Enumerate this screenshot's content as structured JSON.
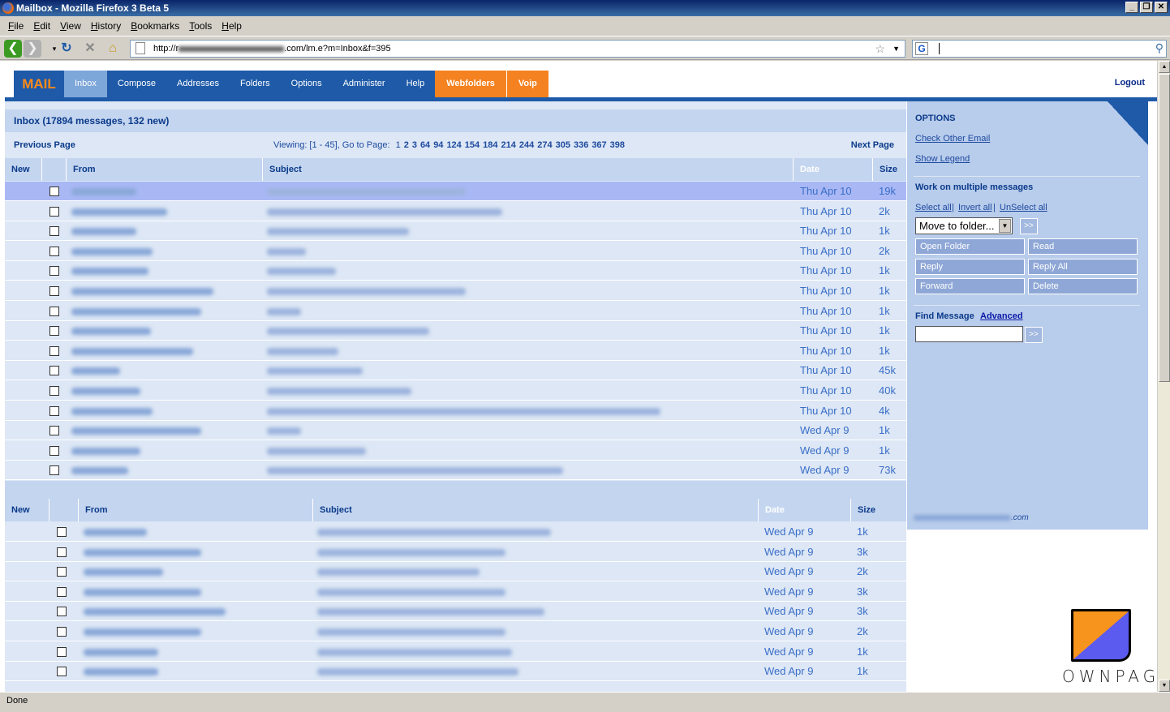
{
  "window": {
    "title": "Mailbox - Mozilla Firefox 3 Beta 5",
    "buttons": [
      "_",
      "❐",
      "✕"
    ]
  },
  "menu": [
    "File",
    "Edit",
    "View",
    "History",
    "Bookmarks",
    "Tools",
    "Help"
  ],
  "browser": {
    "url_prefix": "http://r",
    "url_suffix": ".com/lm.e?m=Inbox&f=395",
    "search_value": ""
  },
  "app": {
    "logo": "MAIL",
    "tabs": [
      "Inbox",
      "Compose",
      "Addresses",
      "Folders",
      "Options",
      "Administer",
      "Help"
    ],
    "orange_tabs": [
      "Webfolders",
      "Voip"
    ],
    "logout": "Logout"
  },
  "inbox": {
    "header": "Inbox (17894 messages, 132 new)",
    "previous": "Previous Page",
    "next": "Next Page",
    "viewing": "Viewing: [1 - 45], Go to Page:",
    "pages": [
      "1",
      "2",
      "3",
      "64",
      "94",
      "124",
      "154",
      "184",
      "214",
      "244",
      "274",
      "305",
      "336",
      "367",
      "398"
    ],
    "columns": {
      "new": "New",
      "from": "From",
      "subject": "Subject",
      "date": "Date",
      "size": "Size"
    },
    "rows_top": [
      {
        "date": "Thu Apr 10",
        "size": "19k",
        "sel": true,
        "fw": 80,
        "sw": 245
      },
      {
        "date": "Thu Apr 10",
        "size": "2k",
        "fw": 118,
        "sw": 290
      },
      {
        "date": "Thu Apr 10",
        "size": "1k",
        "fw": 80,
        "sw": 175
      },
      {
        "date": "Thu Apr 10",
        "size": "2k",
        "fw": 100,
        "sw": 48
      },
      {
        "date": "Thu Apr 10",
        "size": "1k",
        "fw": 95,
        "sw": 85
      },
      {
        "date": "Thu Apr 10",
        "size": "1k",
        "fw": 175,
        "sw": 245
      },
      {
        "date": "Thu Apr 10",
        "size": "1k",
        "fw": 160,
        "sw": 42
      },
      {
        "date": "Thu Apr 10",
        "size": "1k",
        "fw": 98,
        "sw": 200
      },
      {
        "date": "Thu Apr 10",
        "size": "1k",
        "fw": 150,
        "sw": 88
      },
      {
        "date": "Thu Apr 10",
        "size": "45k",
        "fw": 60,
        "sw": 118
      },
      {
        "date": "Thu Apr 10",
        "size": "40k",
        "fw": 85,
        "sw": 178
      },
      {
        "date": "Thu Apr 10",
        "size": "4k",
        "fw": 100,
        "sw": 485
      },
      {
        "date": "Wed Apr 9",
        "size": "1k",
        "fw": 160,
        "sw": 42
      },
      {
        "date": "Wed Apr 9",
        "size": "1k",
        "fw": 85,
        "sw": 122
      },
      {
        "date": "Wed Apr 9",
        "size": "73k",
        "fw": 70,
        "sw": 365
      }
    ],
    "rows_bottom": [
      {
        "date": "Wed Apr 9",
        "size": "1k",
        "fw": 78,
        "sw": 288
      },
      {
        "date": "Wed Apr 9",
        "size": "3k",
        "fw": 145,
        "sw": 232
      },
      {
        "date": "Wed Apr 9",
        "size": "2k",
        "fw": 98,
        "sw": 200
      },
      {
        "date": "Wed Apr 9",
        "size": "3k",
        "fw": 145,
        "sw": 232
      },
      {
        "date": "Wed Apr 9",
        "size": "3k",
        "fw": 175,
        "sw": 280
      },
      {
        "date": "Wed Apr 9",
        "size": "2k",
        "fw": 145,
        "sw": 232
      },
      {
        "date": "Wed Apr 9",
        "size": "1k",
        "fw": 92,
        "sw": 240
      },
      {
        "date": "Wed Apr 9",
        "size": "1k",
        "fw": 92,
        "sw": 248
      }
    ]
  },
  "options": {
    "title": "OPTIONS",
    "check_other": "Check Other Email",
    "show_legend": "Show Legend",
    "work_title": "Work on multiple messages",
    "select_all": "Select all",
    "invert_all": "Invert all",
    "unselect_all": "UnSelect all",
    "separator": "|",
    "move_to": "Move to folder...",
    "go": ">>",
    "actions": [
      "Open Folder",
      "Read",
      "Reply",
      "Reply All",
      "Forward",
      "Delete"
    ],
    "find_label": "Find Message",
    "advanced": "Advanced",
    "email_suffix": ".com"
  },
  "footer_logo": "OWNPAGES",
  "status": "Done"
}
